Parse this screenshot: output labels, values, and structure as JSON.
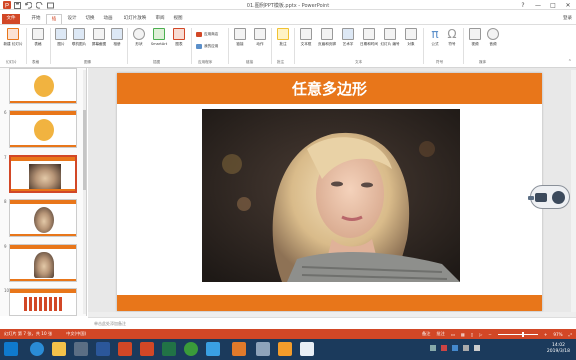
{
  "window": {
    "title": "01.图例PPT模板.pptx - PowerPoint",
    "controls": [
      "?",
      "—",
      "□",
      "✕"
    ]
  },
  "tabs": [
    {
      "label": "文件",
      "kind": "file"
    },
    {
      "label": "插入",
      "kind": "active"
    },
    {
      "label": "开始",
      "kind": "normal"
    },
    {
      "label": "设计",
      "kind": "normal"
    },
    {
      "label": "切换",
      "kind": "normal"
    },
    {
      "label": "动画",
      "kind": "normal"
    },
    {
      "label": "幻灯片放映",
      "kind": "normal"
    },
    {
      "label": "审阅",
      "kind": "normal"
    },
    {
      "label": "视图",
      "kind": "normal"
    }
  ],
  "account": "登录",
  "ribbon": {
    "buttons": [
      {
        "label": "新建\n幻灯片",
        "color": "#e8761a"
      },
      {
        "label": "表格",
        "color": "#5b8fc9"
      },
      {
        "label": "图片",
        "color": "#5b8fc9"
      },
      {
        "label": "联机图片",
        "color": "#5b8fc9"
      },
      {
        "label": "屏幕截图",
        "color": "#5b8fc9"
      },
      {
        "label": "相册",
        "color": "#5b8fc9"
      },
      {
        "label": "形状",
        "color": "#5b8fc9"
      },
      {
        "label": "SmartArt",
        "color": "#4caf50"
      },
      {
        "label": "图表",
        "color": "#d24726"
      },
      {
        "label": "链接",
        "color": "#5b8fc9"
      },
      {
        "label": "动作",
        "color": "#999999"
      },
      {
        "label": "批注",
        "color": "#f1c232"
      },
      {
        "label": "文本框",
        "color": "#5b8fc9"
      },
      {
        "label": "页眉和页脚",
        "color": "#5b8fc9"
      },
      {
        "label": "艺术字",
        "color": "#5b8fc9"
      },
      {
        "label": "日期和时间",
        "color": "#5b8fc9"
      },
      {
        "label": "幻灯片\n编号",
        "color": "#5b8fc9"
      },
      {
        "label": "对象",
        "color": "#5b8fc9"
      },
      {
        "label": "公式",
        "color": "#5b8fc9"
      },
      {
        "label": "符号",
        "color": "#5b8fc9"
      },
      {
        "label": "视频",
        "color": "#5b8fc9"
      },
      {
        "label": "音频",
        "color": "#5b8fc9"
      }
    ],
    "app_items": [
      {
        "label": "应用商店",
        "color": "#d24726"
      },
      {
        "label": "我的应用",
        "color": "#5b8fc9"
      }
    ],
    "groups": [
      "幻灯片",
      "表格",
      "图像",
      "插图",
      "应用程序",
      "链接",
      "批注",
      "文本",
      "符号",
      "媒体"
    ]
  },
  "thumbnails": [
    {
      "num": "",
      "kind": "question"
    },
    {
      "num": "6",
      "kind": "question"
    },
    {
      "num": "7",
      "kind": "portrait",
      "selected": true
    },
    {
      "num": "8",
      "kind": "portrait"
    },
    {
      "num": "9",
      "kind": "portrait"
    },
    {
      "num": "10",
      "kind": "text"
    }
  ],
  "slide": {
    "title": "任意多边形",
    "accent": "#e8761a"
  },
  "notes_placeholder": "单击此处添加备注",
  "status": {
    "left": "幻灯片 第 7 张，共 10 张",
    "lang": "中文(中国)",
    "notes": "备注",
    "comments": "批注",
    "zoom": "97%"
  },
  "taskbar": {
    "time": "14:02",
    "date": "2019/3/18",
    "apps": [
      "start",
      "ie",
      "explorer",
      "video",
      "word",
      "powerpoint",
      "excel",
      "xmind",
      "photos",
      "paint",
      "app",
      "player",
      "folder",
      "powerpoint2"
    ]
  },
  "colors": {
    "office_accent": "#d24726",
    "slide_accent": "#e8761a",
    "taskbar": "#1b3a5c"
  }
}
